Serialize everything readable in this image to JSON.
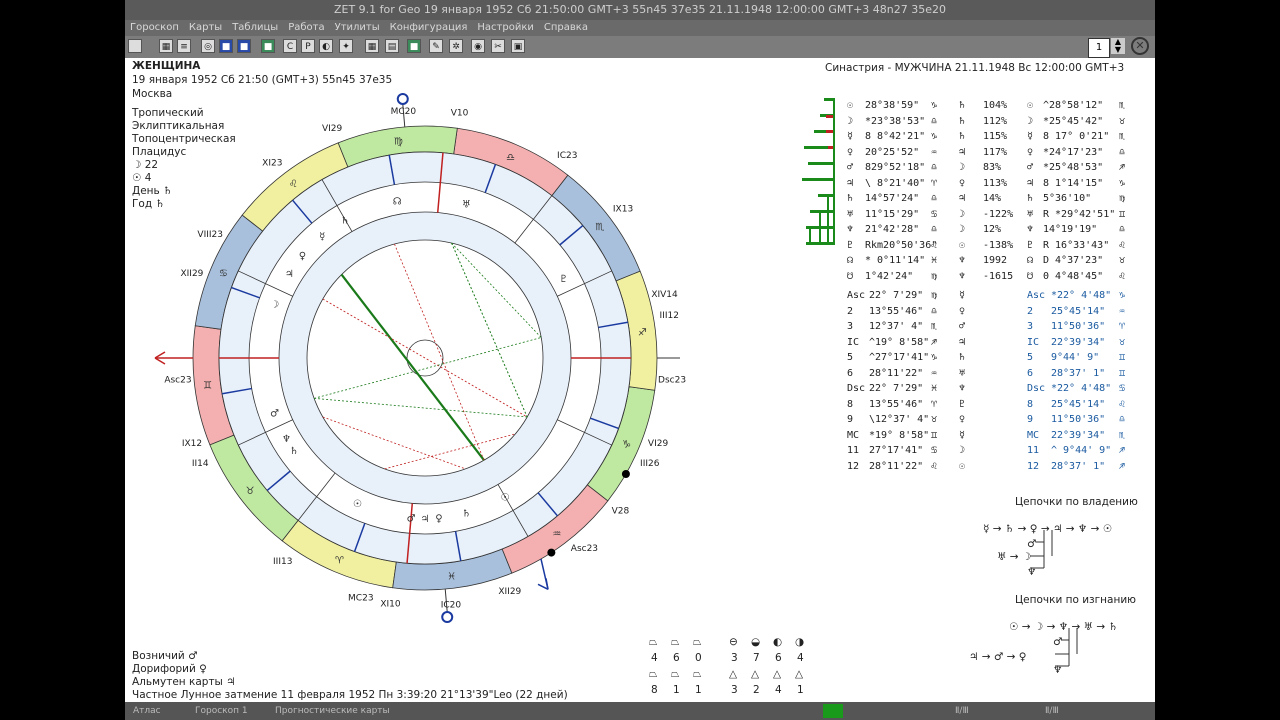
{
  "window": {
    "title": "ZET 9.1 for Geo   19 января 1952   Сб  21:50:00 GMT+3 55n45  37e35   21.11.1948  12:00:00 GMT+3 48n27 35e20",
    "menu": [
      "Гороскоп",
      "Карты",
      "Таблицы",
      "Работа",
      "Утилиты",
      "Конфигурация",
      "Настройки",
      "Справка"
    ],
    "page_input": "1",
    "status": [
      "Атлас",
      "Гороскоп 1",
      "Прогностические карты",
      "Ⅱ/Ⅲ",
      "Ⅱ/Ⅲ"
    ]
  },
  "chart_info": {
    "name": "ЖЕНЩИНА",
    "datetime": "19 января 1952  Сб  21:50 (GMT+3) 55n45  37e35",
    "city": "Москва",
    "settings": [
      "Тропический",
      "Эклиптикальная",
      "Топоцентрическая",
      "Плацидус"
    ],
    "moon_line": "☽  22",
    "sun_line": "☉  4",
    "day_line": "День  ♄",
    "year_line": "Год  ♄"
  },
  "synastry_title": "Синастрия - МУЖЧИНА 21.11.1948  Вс 12:00:00 GMT+3",
  "planets": [
    {
      "sym": "☉",
      "pos": "28°38'59\"",
      "sign": "♑",
      "ruler": "♄",
      "pct": "104%",
      "pg": "☉",
      "ppos": "^28°58'12\"",
      "psign": "♏"
    },
    {
      "sym": "☽",
      "pos": "*23°38'53\"",
      "sign": "♎",
      "ruler": "♄",
      "pct": "112%",
      "pg": "☽",
      "ppos": "*25°45'42\"",
      "psign": "♉"
    },
    {
      "sym": "☿",
      "pos": "8 8°42'21\"",
      "sign": "♑",
      "ruler": "♄",
      "pct": "115%",
      "pg": "☿",
      "ppos": "8 17° 0'21\"",
      "psign": "♏"
    },
    {
      "sym": "♀",
      "pos": "20°25'52\"",
      "sign": "♒",
      "ruler": "♃",
      "pct": "117%",
      "pg": "♀",
      "ppos": "*24°17'23\"",
      "psign": "♎"
    },
    {
      "sym": "♂",
      "pos": "829°52'18\"",
      "sign": "♎",
      "ruler": "☽",
      "pct": "83%",
      "pg": "♂",
      "ppos": "*25°48'53\"",
      "psign": "♐"
    },
    {
      "sym": "♃",
      "pos": "\\ 8°21'40\"",
      "sign": "♈",
      "ruler": "♀",
      "pct": "113%",
      "pg": "♃",
      "ppos": "8 1°14'15\"",
      "psign": "♑"
    },
    {
      "sym": "♄",
      "pos": "14°57'24\"",
      "sign": "♎",
      "ruler": "♃",
      "pct": "14%",
      "pg": "♄",
      "ppos": "5°36'10\"",
      "psign": "♍"
    },
    {
      "sym": "♅",
      "pos": "11°15'29\"",
      "sign": "♋",
      "ruler": "☽",
      "pct": "-122%",
      "pg": "♅",
      "ppos": "R *29°42'51\"",
      "psign": "♊"
    },
    {
      "sym": "♆",
      "pos": "21°42'28\"",
      "sign": "♎",
      "ruler": "☽",
      "pct": "12%",
      "pg": "♆",
      "ppos": "14°19'19\"",
      "psign": "♎"
    },
    {
      "sym": "♇",
      "pos": "Rkm20°50'36\"",
      "sign": "♌",
      "ruler": "☉",
      "pct": "-138%",
      "pg": "♇",
      "ppos": "R 16°33'43\"",
      "psign": "♌"
    },
    {
      "sym": "☊",
      "pos": "* 0°11'14\"",
      "sign": "♓",
      "ruler": "♆",
      "pct": "1992",
      "pg": "☊",
      "ppos": "D 4°37'23\"",
      "psign": "♉"
    },
    {
      "sym": "☋",
      "pos": "1°42'24\"",
      "sign": "♍",
      "ruler": "♆",
      "pct": "-1615",
      "pg": "☋",
      "ppos": "0 4°48'45\"",
      "psign": "♌"
    }
  ],
  "houses": [
    {
      "sym": "Asc",
      "pos": "22° 7'29\"",
      "sign": "♍",
      "ruler": "☿",
      "psym": "Asc",
      "ppos": "*22° 4'48\"",
      "psign": "♑"
    },
    {
      "sym": "2",
      "pos": "13°55'46\"",
      "sign": "♎",
      "ruler": "♀",
      "psym": "2",
      "ppos": "25°45'14\"",
      "psign": "♒"
    },
    {
      "sym": "3",
      "pos": "12°37' 4\"",
      "sign": "♏",
      "ruler": "♂",
      "psym": "3",
      "ppos": "11°50'36\"",
      "psign": "♈"
    },
    {
      "sym": "IC",
      "pos": "^19° 8'58\"",
      "sign": "♐",
      "ruler": "♃",
      "psym": "IC",
      "ppos": "22°39'34\"",
      "psign": "♉"
    },
    {
      "sym": "5",
      "pos": "^27°17'41\"",
      "sign": "♑",
      "ruler": "♄",
      "psym": "5",
      "ppos": "9°44' 9\"",
      "psign": "♊"
    },
    {
      "sym": "6",
      "pos": "28°11'22\"",
      "sign": "♒",
      "ruler": "♅",
      "psym": "6",
      "ppos": "28°37' 1\"",
      "psign": "♊"
    },
    {
      "sym": "Dsc",
      "pos": "22° 7'29\"",
      "sign": "♓",
      "ruler": "♆",
      "psym": "Dsc",
      "ppos": "*22° 4'48\"",
      "psign": "♋"
    },
    {
      "sym": "8",
      "pos": "13°55'46\"",
      "sign": "♈",
      "ruler": "♇",
      "psym": "8",
      "ppos": "25°45'14\"",
      "psign": "♌"
    },
    {
      "sym": "9",
      "pos": "\\12°37' 4\"",
      "sign": "♉",
      "ruler": "♀",
      "psym": "9",
      "ppos": "11°50'36\"",
      "psign": "♎"
    },
    {
      "sym": "MC",
      "pos": "*19° 8'58\"",
      "sign": "♊",
      "ruler": "☿",
      "psym": "MC",
      "ppos": "22°39'34\"",
      "psign": "♏"
    },
    {
      "sym": "11",
      "pos": "27°17'41\"",
      "sign": "♋",
      "ruler": "☽",
      "psym": "11",
      "ppos": "^ 9°44' 9\"",
      "psign": "♐"
    },
    {
      "sym": "12",
      "pos": "28°11'22\"",
      "sign": "♌",
      "ruler": "☉",
      "psym": "12",
      "ppos": "28°37' 1\"",
      "psign": "♐"
    }
  ],
  "chains": {
    "domicile_title": "Цепочки по владению",
    "domicile_line1": "☿ → ♄ → ♀ → ♃ → ♆ → ☉",
    "domicile_line2": "♂",
    "domicile_line3": "♅ → ☽",
    "domicile_line4": "♆",
    "exile_title": "Цепочки по изгнанию",
    "exile_line1": "☉ → ☽ → ♆ → ♅ → ♄",
    "exile_line2": "♂",
    "exile_line3": "♃ → ♂ → ♀",
    "exile_line4": "♆"
  },
  "footer": {
    "charioteer": "Возничий  ♂",
    "doryphory": "Дорифорий  ♀",
    "almuten": "Альмутен карты  ♃",
    "eclipse": "Частное Лунное затмение 11 февраля 1952 Пн  3:39:20 21°13'39\"Leo (22 дней)"
  },
  "stats": {
    "top_values": [
      "4",
      "6",
      "0",
      "3",
      "7",
      "6",
      "4"
    ],
    "bottom_values": [
      "8",
      "1",
      "1",
      "3",
      "2",
      "4",
      "1"
    ]
  },
  "wheel": {
    "outer_labels": [
      "MC20",
      "V10",
      "VI29",
      "IC23",
      "IX13",
      "Dsc23",
      "XI23",
      "VIII23",
      "XII29",
      "Asc23",
      "IX12",
      "II14",
      "III13",
      "MC23",
      "XI10",
      "IC20",
      "XII29",
      "V28",
      "Asc23",
      "VI29",
      "III26",
      "XIV14",
      "III12"
    ],
    "signs": [
      "♊",
      "♉",
      "♈",
      "♓",
      "♒",
      "♑",
      "♐",
      "♏",
      "♎",
      "♍",
      "♌",
      "♋"
    ]
  }
}
